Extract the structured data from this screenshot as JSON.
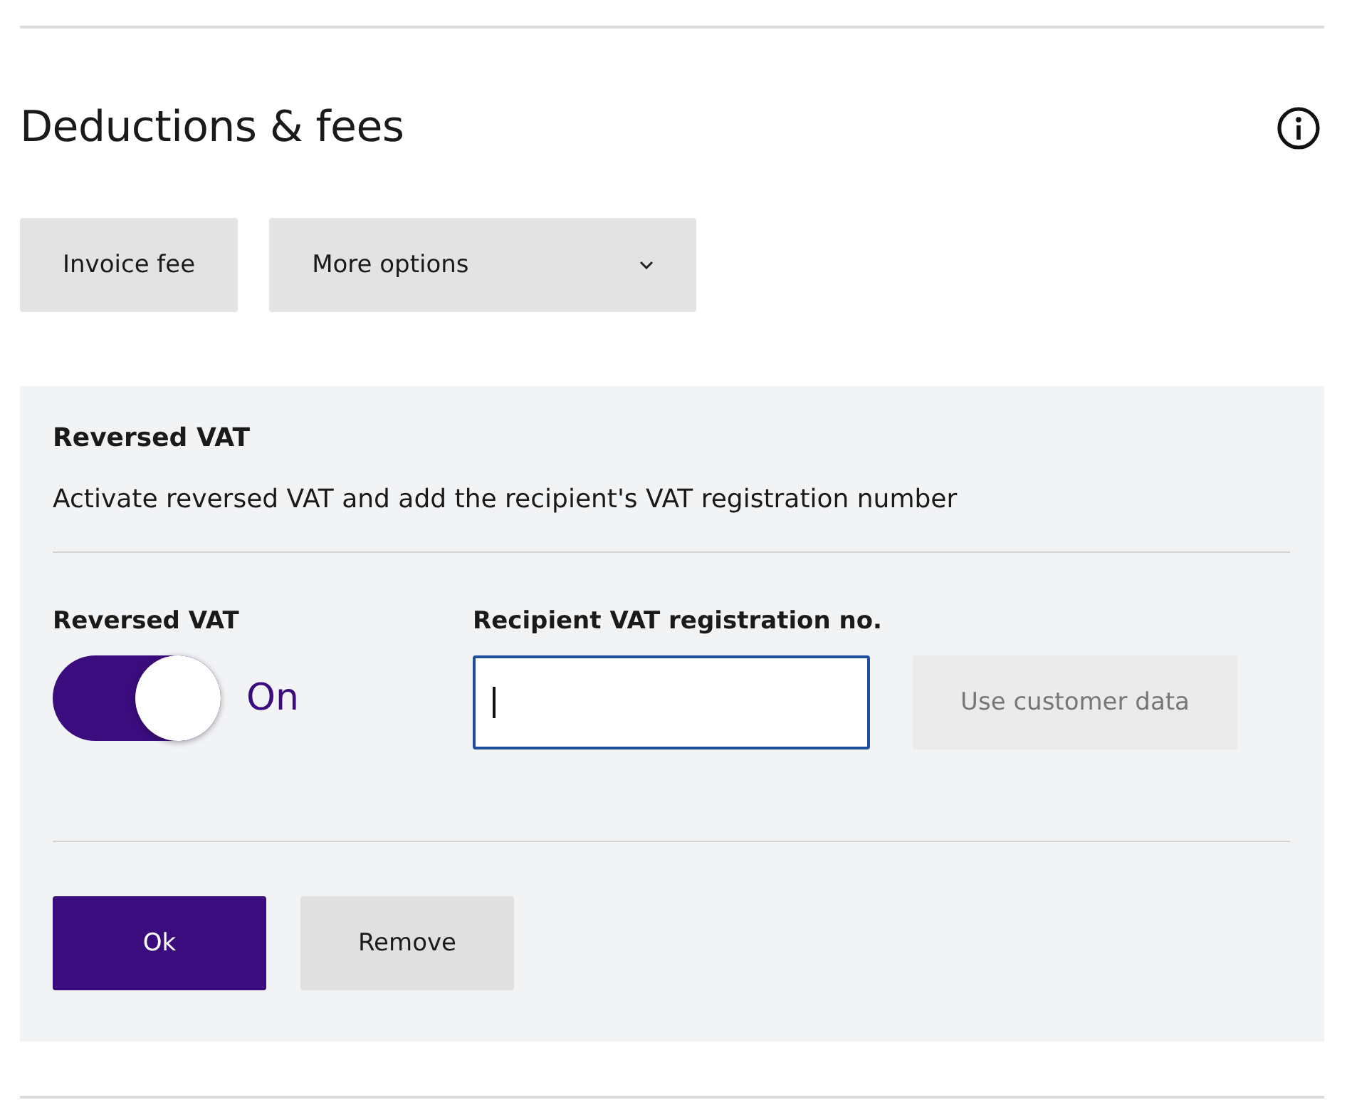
{
  "section": {
    "title": "Deductions & fees"
  },
  "option_buttons": [
    {
      "label": "Invoice fee",
      "kind": "plain"
    },
    {
      "label": "More options",
      "kind": "dropdown"
    }
  ],
  "panel": {
    "title": "Reversed VAT",
    "description": "Activate reversed VAT and add the recipient's VAT registration number",
    "toggle": {
      "label": "Reversed VAT",
      "on": true,
      "state_text": "On"
    },
    "vat_field": {
      "label": "Recipient VAT registration no.",
      "focused": true
    },
    "customer_data_button": {
      "label": "Use customer data",
      "disabled": true
    },
    "actions": [
      {
        "label": "Ok",
        "kind": "primary"
      },
      {
        "label": "Remove",
        "kind": "secondary"
      }
    ]
  }
}
